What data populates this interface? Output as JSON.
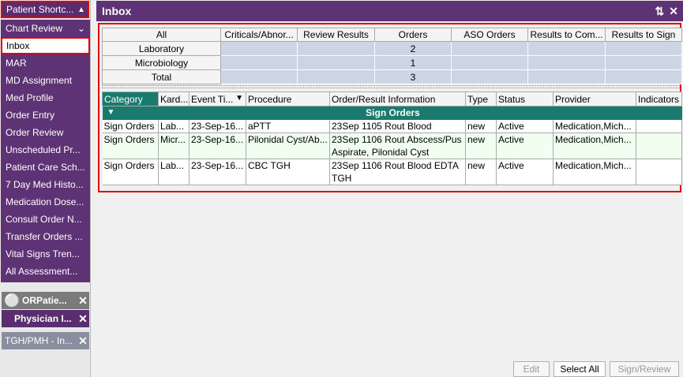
{
  "sidebar": {
    "header": "Patient Shortc...",
    "items": [
      {
        "label": "Chart Review"
      },
      {
        "label": "Inbox"
      },
      {
        "label": "MAR"
      },
      {
        "label": "MD Assignment"
      },
      {
        "label": "Med Profile"
      },
      {
        "label": "Order Entry"
      },
      {
        "label": "Order Review"
      },
      {
        "label": "Unscheduled Pr..."
      },
      {
        "label": "Patient Care Sch..."
      },
      {
        "label": "7 Day Med Histo..."
      },
      {
        "label": "Medication Dose..."
      },
      {
        "label": "Consult Order N..."
      },
      {
        "label": "Transfer Orders ..."
      },
      {
        "label": "Vital Signs Tren..."
      },
      {
        "label": "All Assessment..."
      }
    ],
    "patient_tab": "ORPatie...",
    "physician_tab": "Physician I...",
    "location_tab": "TGH/PMH - In..."
  },
  "main": {
    "title": "Inbox",
    "summary": {
      "columns": [
        "All",
        "Criticals/Abnor...",
        "Review Results",
        "Orders",
        "ASO Orders",
        "Results to Com...",
        "Results to Sign"
      ],
      "rows": [
        {
          "label": "Laboratory",
          "orders": "2"
        },
        {
          "label": "Microbiology",
          "orders": "1"
        },
        {
          "label": "Total",
          "orders": "3"
        }
      ]
    },
    "orders": {
      "columns": [
        "Category",
        "Kard...",
        "Event Ti...",
        "Procedure",
        "Order/Result Information",
        "Type",
        "Status",
        "Provider",
        "Indicators"
      ],
      "group": "Sign Orders",
      "rows": [
        {
          "category": "Sign Orders",
          "kard": "Lab...",
          "event": "23-Sep-16...",
          "procedure": "aPTT",
          "info": "23Sep 1105 Rout Blood",
          "type": "new",
          "status": "Active",
          "provider": "Medication,Mich...",
          "indicators": ""
        },
        {
          "category": "Sign Orders",
          "kard": "Micr...",
          "event": "23-Sep-16...",
          "procedure": "Pilonidal Cyst/Ab...",
          "info": "23Sep 1106 Rout Abscess/Pus Aspirate, Pilonidal Cyst",
          "type": "new",
          "status": "Active",
          "provider": "Medication,Mich...",
          "indicators": ""
        },
        {
          "category": "Sign Orders",
          "kard": "Lab...",
          "event": "23-Sep-16...",
          "procedure": "CBC TGH",
          "info": "23Sep 1106 Rout Blood EDTA TGH",
          "type": "new",
          "status": "Active",
          "provider": "Medication,Mich...",
          "indicators": ""
        }
      ]
    },
    "buttons": {
      "edit": "Edit",
      "select_all": "Select All",
      "sign_review": "Sign/Review"
    }
  },
  "colors": {
    "purple": "#5e3375",
    "teal": "#1a7a6e",
    "highlight": "#e00000"
  }
}
